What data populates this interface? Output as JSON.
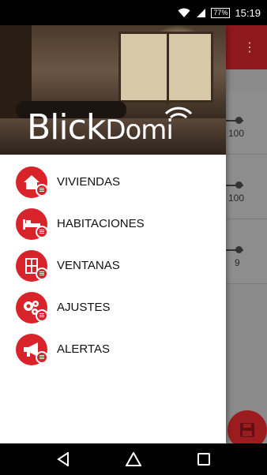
{
  "status_bar": {
    "battery": "77",
    "time": "15:19",
    "icons": [
      "wifi-icon",
      "signal-icon",
      "battery-icon"
    ]
  },
  "drawer": {
    "logo": {
      "part1": "Blick",
      "part2": "Domi"
    },
    "items": [
      {
        "label": "VIVIENDAS",
        "icon": "house-icon"
      },
      {
        "label": "HABITACIONES",
        "icon": "bed-icon"
      },
      {
        "label": "VENTANAS",
        "icon": "window-icon"
      },
      {
        "label": "AJUSTES",
        "icon": "gears-icon"
      },
      {
        "label": "ALERTAS",
        "icon": "megaphone-icon"
      }
    ]
  },
  "background": {
    "values": [
      "100",
      "100",
      "9"
    ]
  },
  "colors": {
    "accent": "#d8232a",
    "appbar": "#8f1a1e"
  },
  "nav_bar": {
    "icons": [
      "back-icon",
      "home-icon",
      "recents-icon"
    ]
  }
}
